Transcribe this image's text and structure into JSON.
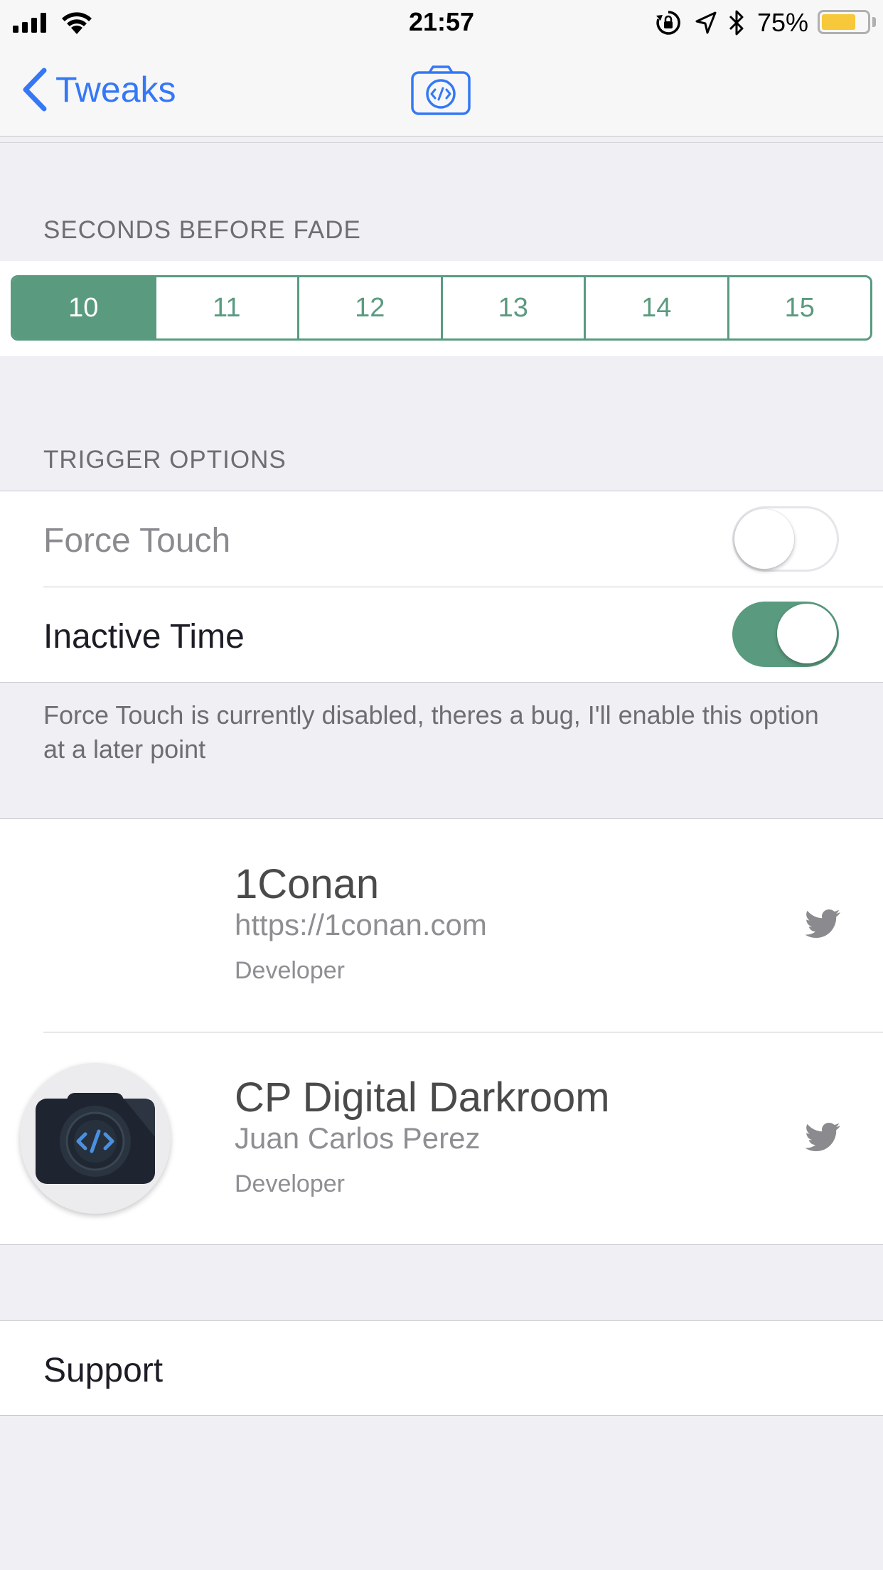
{
  "status_bar": {
    "time": "21:57",
    "battery_percent": "75%",
    "battery_level": 0.75,
    "battery_color": "#f6c83a"
  },
  "nav": {
    "back_label": "Tweaks",
    "title_icon": "code-camera-icon",
    "accent": "#3478f6"
  },
  "fade_section": {
    "header": "SECONDS BEFORE FADE",
    "options": [
      "10",
      "11",
      "12",
      "13",
      "14",
      "15"
    ],
    "selected": "10",
    "accent": "#5a9b7f"
  },
  "trigger_section": {
    "header": "TRIGGER OPTIONS",
    "rows": [
      {
        "label": "Force Touch",
        "enabled": false,
        "on": false
      },
      {
        "label": "Inactive Time",
        "enabled": true,
        "on": true
      }
    ],
    "footer": "Force Touch is currently disabled, theres a bug, I'll enable this option at a later point"
  },
  "developers": [
    {
      "name": "1Conan",
      "subtitle": "https://1conan.com",
      "role": "Developer",
      "link_icon": "twitter-icon",
      "avatar": ""
    },
    {
      "name": "CP Digital Darkroom",
      "subtitle": "Juan Carlos Perez",
      "role": "Developer",
      "link_icon": "twitter-icon",
      "avatar": "code-camera-icon"
    }
  ],
  "support": {
    "label": "Support"
  }
}
